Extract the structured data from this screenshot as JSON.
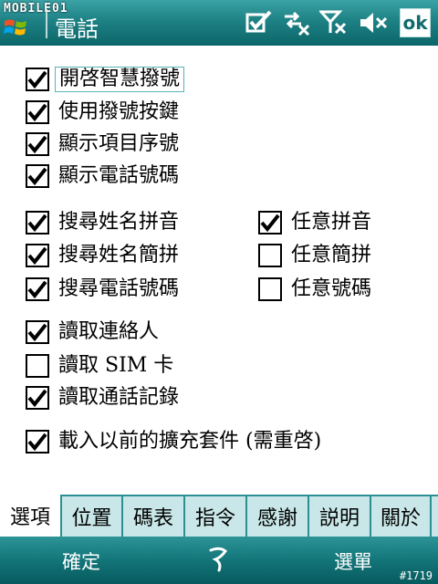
{
  "watermark_top": "MOBILE01",
  "watermark_bottom": "#1719",
  "title": "電話",
  "ok_label": "ok",
  "icons": [
    "windows-start-icon",
    "checklist-icon",
    "data-connection-off-icon",
    "signal-off-icon",
    "speaker-mute-icon"
  ],
  "groups": [
    {
      "items": [
        {
          "label": "開啓智慧撥號",
          "checked": true,
          "focused": true
        },
        {
          "label": "使用撥號按鍵",
          "checked": true
        },
        {
          "label": "顯示項目序號",
          "checked": true
        },
        {
          "label": "顯示電話號碼",
          "checked": true
        }
      ]
    },
    {
      "items": [
        {
          "label": "搜尋姓名拼音",
          "checked": true
        },
        {
          "label": "搜尋姓名簡拼",
          "checked": true
        },
        {
          "label": "搜尋電話號碼",
          "checked": true
        }
      ]
    },
    {
      "items": [
        {
          "label": "任意拼音",
          "checked": true
        },
        {
          "label": "任意簡拼",
          "checked": false
        },
        {
          "label": "任意號碼",
          "checked": false
        }
      ]
    },
    {
      "items": [
        {
          "label": "讀取連絡人",
          "checked": true
        },
        {
          "label": "讀取 SIM 卡",
          "checked": false
        },
        {
          "label": "讀取通話記錄",
          "checked": true
        }
      ]
    },
    {
      "items": [
        {
          "label": "載入以前的擴充套件 (需重啓)",
          "checked": true
        }
      ]
    }
  ],
  "tabs": [
    "選項",
    "位置",
    "碼表",
    "指令",
    "感謝",
    "説明",
    "關於"
  ],
  "active_tab": 0,
  "softkeys": {
    "left": "確定",
    "right": "選單"
  },
  "colors": {
    "title_bar": "#1e8184",
    "tab_strip": "#c9e7e8",
    "accent": "#2e8f92"
  }
}
